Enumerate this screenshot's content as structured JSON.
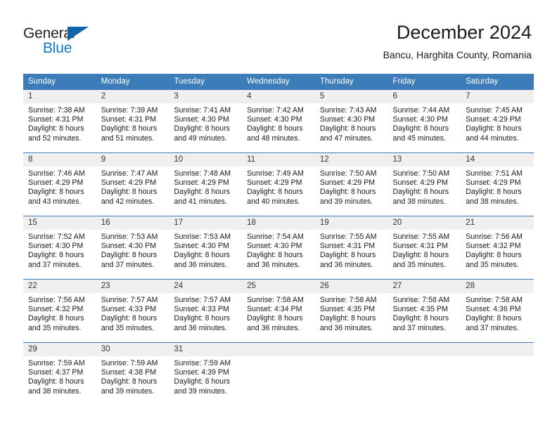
{
  "brand": {
    "name_part1": "General",
    "name_part2": "Blue",
    "triangle_icon": "triangle-icon",
    "accent_color": "#1479C4",
    "dark_color": "#231F20"
  },
  "header": {
    "title": "December 2024",
    "subtitle": "Bancu, Harghita County, Romania"
  },
  "calendar": {
    "header_bg_color": "#3C7CB8",
    "daynum_bg_color": "#EFEFEF",
    "weekdays": [
      "Sunday",
      "Monday",
      "Tuesday",
      "Wednesday",
      "Thursday",
      "Friday",
      "Saturday"
    ],
    "weeks": [
      [
        {
          "day": "1",
          "sunrise": "Sunrise: 7:38 AM",
          "sunset": "Sunset: 4:31 PM",
          "daylight1": "Daylight: 8 hours",
          "daylight2": "and 52 minutes."
        },
        {
          "day": "2",
          "sunrise": "Sunrise: 7:39 AM",
          "sunset": "Sunset: 4:31 PM",
          "daylight1": "Daylight: 8 hours",
          "daylight2": "and 51 minutes."
        },
        {
          "day": "3",
          "sunrise": "Sunrise: 7:41 AM",
          "sunset": "Sunset: 4:30 PM",
          "daylight1": "Daylight: 8 hours",
          "daylight2": "and 49 minutes."
        },
        {
          "day": "4",
          "sunrise": "Sunrise: 7:42 AM",
          "sunset": "Sunset: 4:30 PM",
          "daylight1": "Daylight: 8 hours",
          "daylight2": "and 48 minutes."
        },
        {
          "day": "5",
          "sunrise": "Sunrise: 7:43 AM",
          "sunset": "Sunset: 4:30 PM",
          "daylight1": "Daylight: 8 hours",
          "daylight2": "and 47 minutes."
        },
        {
          "day": "6",
          "sunrise": "Sunrise: 7:44 AM",
          "sunset": "Sunset: 4:30 PM",
          "daylight1": "Daylight: 8 hours",
          "daylight2": "and 45 minutes."
        },
        {
          "day": "7",
          "sunrise": "Sunrise: 7:45 AM",
          "sunset": "Sunset: 4:29 PM",
          "daylight1": "Daylight: 8 hours",
          "daylight2": "and 44 minutes."
        }
      ],
      [
        {
          "day": "8",
          "sunrise": "Sunrise: 7:46 AM",
          "sunset": "Sunset: 4:29 PM",
          "daylight1": "Daylight: 8 hours",
          "daylight2": "and 43 minutes."
        },
        {
          "day": "9",
          "sunrise": "Sunrise: 7:47 AM",
          "sunset": "Sunset: 4:29 PM",
          "daylight1": "Daylight: 8 hours",
          "daylight2": "and 42 minutes."
        },
        {
          "day": "10",
          "sunrise": "Sunrise: 7:48 AM",
          "sunset": "Sunset: 4:29 PM",
          "daylight1": "Daylight: 8 hours",
          "daylight2": "and 41 minutes."
        },
        {
          "day": "11",
          "sunrise": "Sunrise: 7:49 AM",
          "sunset": "Sunset: 4:29 PM",
          "daylight1": "Daylight: 8 hours",
          "daylight2": "and 40 minutes."
        },
        {
          "day": "12",
          "sunrise": "Sunrise: 7:50 AM",
          "sunset": "Sunset: 4:29 PM",
          "daylight1": "Daylight: 8 hours",
          "daylight2": "and 39 minutes."
        },
        {
          "day": "13",
          "sunrise": "Sunrise: 7:50 AM",
          "sunset": "Sunset: 4:29 PM",
          "daylight1": "Daylight: 8 hours",
          "daylight2": "and 38 minutes."
        },
        {
          "day": "14",
          "sunrise": "Sunrise: 7:51 AM",
          "sunset": "Sunset: 4:29 PM",
          "daylight1": "Daylight: 8 hours",
          "daylight2": "and 38 minutes."
        }
      ],
      [
        {
          "day": "15",
          "sunrise": "Sunrise: 7:52 AM",
          "sunset": "Sunset: 4:30 PM",
          "daylight1": "Daylight: 8 hours",
          "daylight2": "and 37 minutes."
        },
        {
          "day": "16",
          "sunrise": "Sunrise: 7:53 AM",
          "sunset": "Sunset: 4:30 PM",
          "daylight1": "Daylight: 8 hours",
          "daylight2": "and 37 minutes."
        },
        {
          "day": "17",
          "sunrise": "Sunrise: 7:53 AM",
          "sunset": "Sunset: 4:30 PM",
          "daylight1": "Daylight: 8 hours",
          "daylight2": "and 36 minutes."
        },
        {
          "day": "18",
          "sunrise": "Sunrise: 7:54 AM",
          "sunset": "Sunset: 4:30 PM",
          "daylight1": "Daylight: 8 hours",
          "daylight2": "and 36 minutes."
        },
        {
          "day": "19",
          "sunrise": "Sunrise: 7:55 AM",
          "sunset": "Sunset: 4:31 PM",
          "daylight1": "Daylight: 8 hours",
          "daylight2": "and 36 minutes."
        },
        {
          "day": "20",
          "sunrise": "Sunrise: 7:55 AM",
          "sunset": "Sunset: 4:31 PM",
          "daylight1": "Daylight: 8 hours",
          "daylight2": "and 35 minutes."
        },
        {
          "day": "21",
          "sunrise": "Sunrise: 7:56 AM",
          "sunset": "Sunset: 4:32 PM",
          "daylight1": "Daylight: 8 hours",
          "daylight2": "and 35 minutes."
        }
      ],
      [
        {
          "day": "22",
          "sunrise": "Sunrise: 7:56 AM",
          "sunset": "Sunset: 4:32 PM",
          "daylight1": "Daylight: 8 hours",
          "daylight2": "and 35 minutes."
        },
        {
          "day": "23",
          "sunrise": "Sunrise: 7:57 AM",
          "sunset": "Sunset: 4:33 PM",
          "daylight1": "Daylight: 8 hours",
          "daylight2": "and 35 minutes."
        },
        {
          "day": "24",
          "sunrise": "Sunrise: 7:57 AM",
          "sunset": "Sunset: 4:33 PM",
          "daylight1": "Daylight: 8 hours",
          "daylight2": "and 36 minutes."
        },
        {
          "day": "25",
          "sunrise": "Sunrise: 7:58 AM",
          "sunset": "Sunset: 4:34 PM",
          "daylight1": "Daylight: 8 hours",
          "daylight2": "and 36 minutes."
        },
        {
          "day": "26",
          "sunrise": "Sunrise: 7:58 AM",
          "sunset": "Sunset: 4:35 PM",
          "daylight1": "Daylight: 8 hours",
          "daylight2": "and 36 minutes."
        },
        {
          "day": "27",
          "sunrise": "Sunrise: 7:58 AM",
          "sunset": "Sunset: 4:35 PM",
          "daylight1": "Daylight: 8 hours",
          "daylight2": "and 37 minutes."
        },
        {
          "day": "28",
          "sunrise": "Sunrise: 7:58 AM",
          "sunset": "Sunset: 4:36 PM",
          "daylight1": "Daylight: 8 hours",
          "daylight2": "and 37 minutes."
        }
      ],
      [
        {
          "day": "29",
          "sunrise": "Sunrise: 7:59 AM",
          "sunset": "Sunset: 4:37 PM",
          "daylight1": "Daylight: 8 hours",
          "daylight2": "and 38 minutes."
        },
        {
          "day": "30",
          "sunrise": "Sunrise: 7:59 AM",
          "sunset": "Sunset: 4:38 PM",
          "daylight1": "Daylight: 8 hours",
          "daylight2": "and 39 minutes."
        },
        {
          "day": "31",
          "sunrise": "Sunrise: 7:59 AM",
          "sunset": "Sunset: 4:39 PM",
          "daylight1": "Daylight: 8 hours",
          "daylight2": "and 39 minutes."
        },
        {
          "day": "",
          "sunrise": "",
          "sunset": "",
          "daylight1": "",
          "daylight2": ""
        },
        {
          "day": "",
          "sunrise": "",
          "sunset": "",
          "daylight1": "",
          "daylight2": ""
        },
        {
          "day": "",
          "sunrise": "",
          "sunset": "",
          "daylight1": "",
          "daylight2": ""
        },
        {
          "day": "",
          "sunrise": "",
          "sunset": "",
          "daylight1": "",
          "daylight2": ""
        }
      ]
    ]
  }
}
